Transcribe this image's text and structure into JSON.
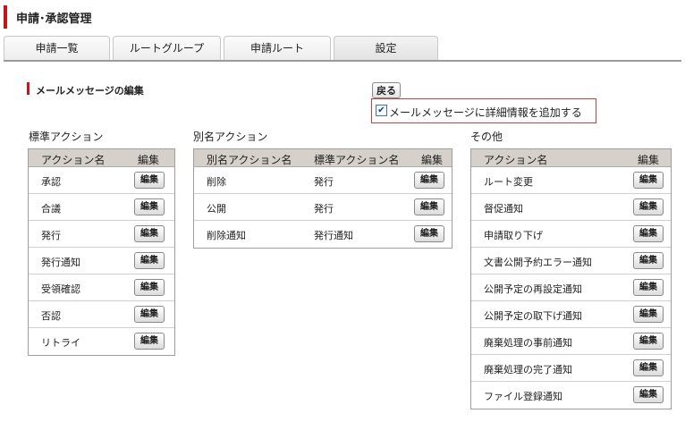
{
  "header": {
    "title": "申請･承認管理"
  },
  "tabs": [
    {
      "label": "申請一覧"
    },
    {
      "label": "ルートグループ"
    },
    {
      "label": "申請ルート"
    },
    {
      "label": "設定"
    }
  ],
  "section": {
    "title": "メールメッセージの編集"
  },
  "back_button": {
    "label": "戻る"
  },
  "detail_option": {
    "label": "メールメッセージに詳細情報を追加する",
    "checked": true
  },
  "standard": {
    "title": "標準アクション",
    "col_name": "アクション名",
    "col_edit": "編集",
    "rows": [
      {
        "name": "承認",
        "edit": "編集"
      },
      {
        "name": "合議",
        "edit": "編集"
      },
      {
        "name": "発行",
        "edit": "編集"
      },
      {
        "name": "発行通知",
        "edit": "編集"
      },
      {
        "name": "受領確認",
        "edit": "編集"
      },
      {
        "name": "否認",
        "edit": "編集"
      },
      {
        "name": "リトライ",
        "edit": "編集"
      }
    ]
  },
  "alias": {
    "title": "別名アクション",
    "col_alias": "別名アクション名",
    "col_standard": "標準アクション名",
    "col_edit": "編集",
    "rows": [
      {
        "alias": "削除",
        "standard": "発行",
        "edit": "編集"
      },
      {
        "alias": "公開",
        "standard": "発行",
        "edit": "編集"
      },
      {
        "alias": "削除通知",
        "standard": "発行通知",
        "edit": "編集"
      }
    ]
  },
  "other": {
    "title": "その他",
    "col_name": "アクション名",
    "col_edit": "編集",
    "rows": [
      {
        "name": "ルート変更",
        "edit": "編集"
      },
      {
        "name": "督促通知",
        "edit": "編集"
      },
      {
        "name": "申請取り下げ",
        "edit": "編集"
      },
      {
        "name": "文書公開予約エラー通知",
        "edit": "編集"
      },
      {
        "name": "公開予定の再設定通知",
        "edit": "編集"
      },
      {
        "name": "公開予定の取下げ通知",
        "edit": "編集"
      },
      {
        "name": "廃棄処理の事前通知",
        "edit": "編集"
      },
      {
        "name": "廃棄処理の完了通知",
        "edit": "編集"
      },
      {
        "name": "ファイル登録通知",
        "edit": "編集"
      }
    ]
  },
  "colors": {
    "accent": "#c4171d",
    "table_header": "#d5d1ca",
    "highlight_border": "#c84040"
  }
}
